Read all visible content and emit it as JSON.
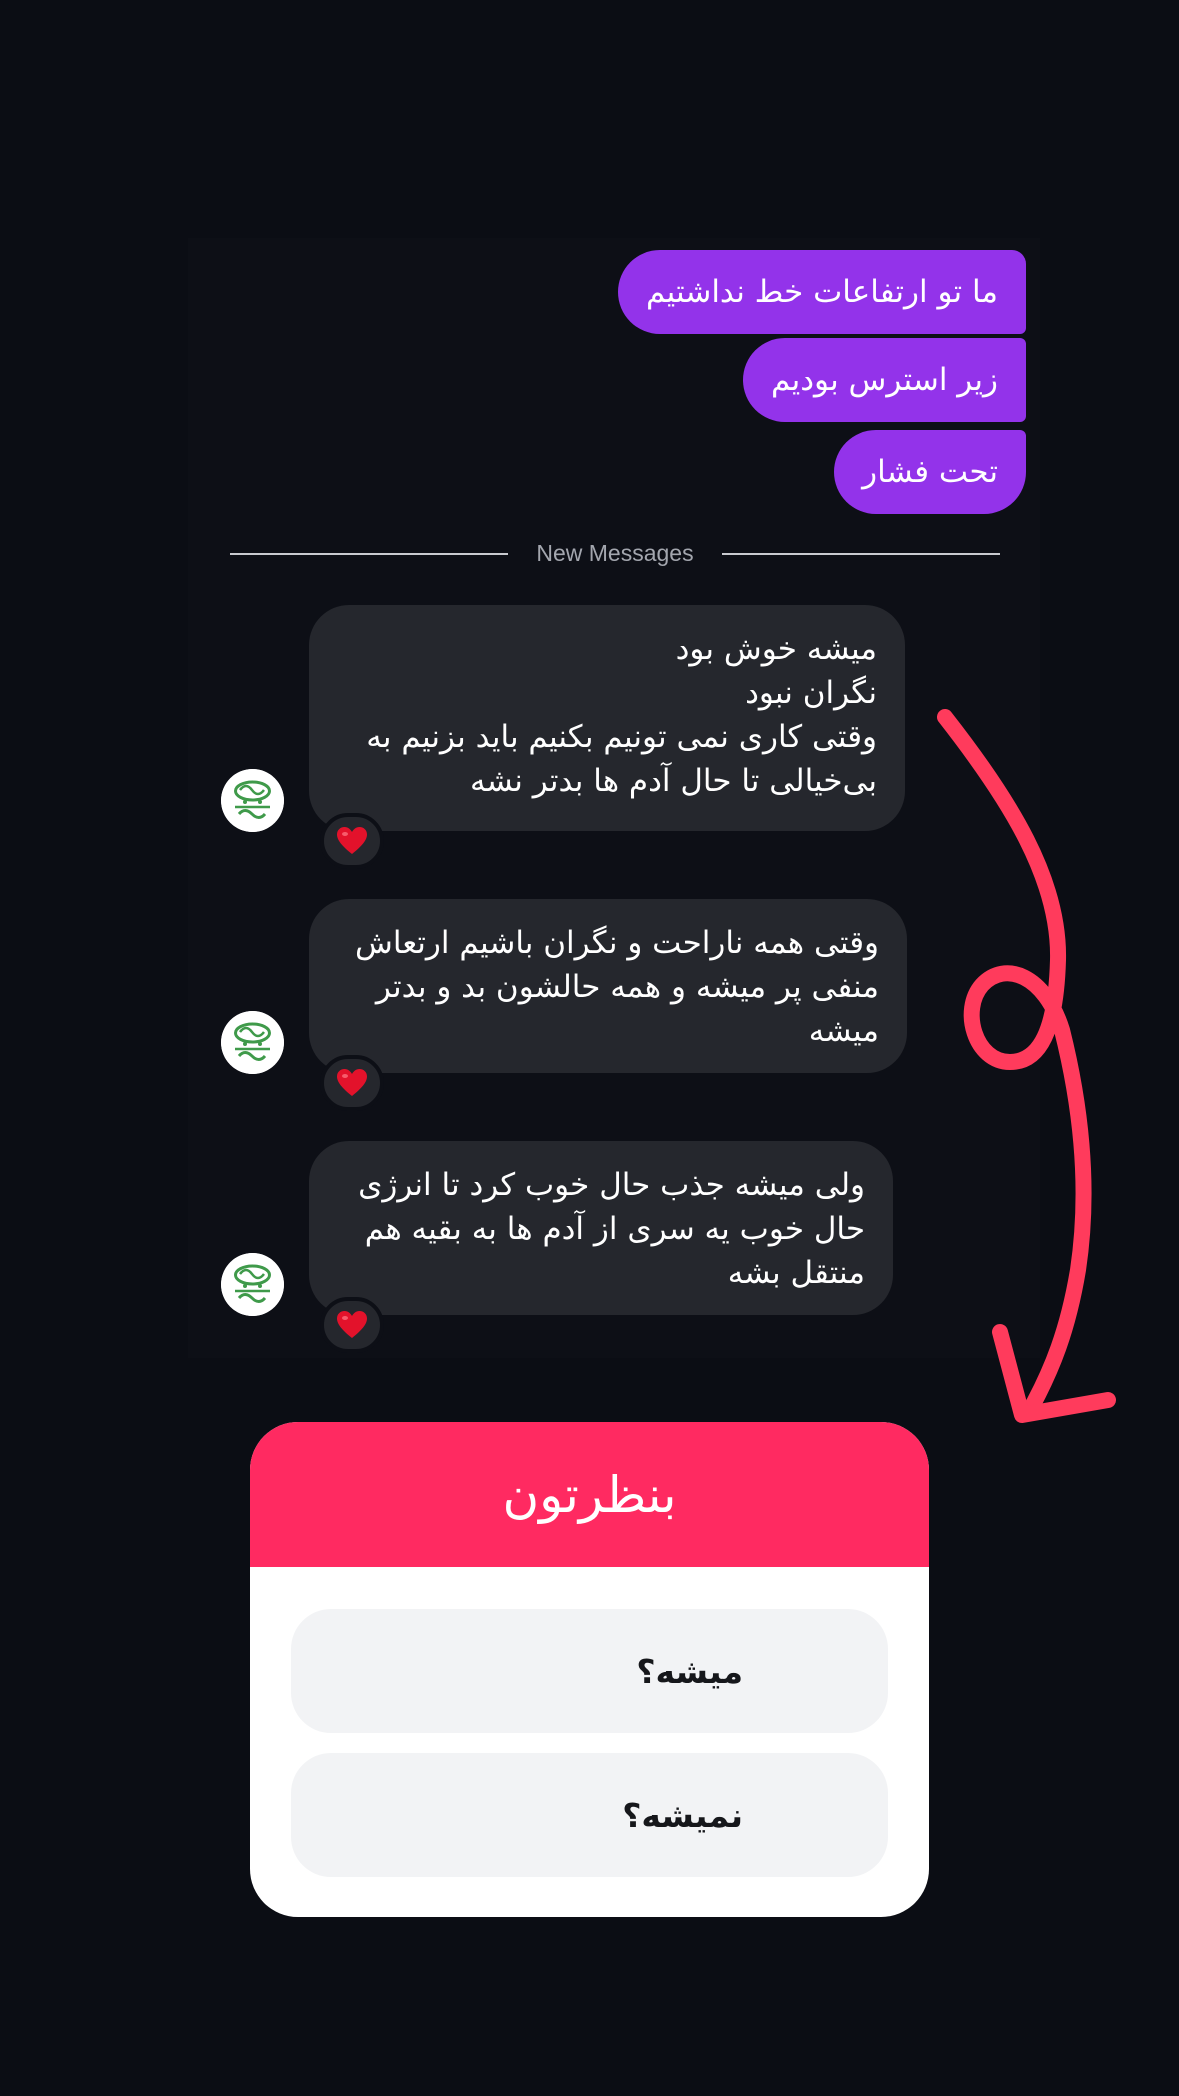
{
  "outgoing_messages": [
    "ما تو ارتفاعات خط نداشتیم",
    "زیر استرس بودیم",
    "تحت فشار"
  ],
  "divider": {
    "label": "New Messages"
  },
  "incoming_messages": [
    {
      "lines": [
        "میشه خوش بود",
        "نگران نبود",
        "وقتی کاری نمی تونیم بکنیم باید بزنیم به",
        "بی‌خیالی تا حال آدم ها بدتر نشه"
      ],
      "reaction": "❤️"
    },
    {
      "lines": [
        "وقتی همه ناراحت و نگران باشیم ارتعاش",
        "منفی پر میشه و همه حالشون بد و بدتر",
        "میشه"
      ],
      "reaction": "❤️"
    },
    {
      "lines": [
        "ولی میشه جذب حال خوب کرد تا انرژی",
        "حال خوب یه سری از آدم ها به بقیه هم",
        "منتقل بشه"
      ],
      "reaction": "❤️"
    }
  ],
  "poll": {
    "title": "بنظرتون",
    "options": [
      "میشه؟",
      "نمیشه؟"
    ]
  },
  "colors": {
    "background": "#0b0d14",
    "outgoing_bubble": "#9333ea",
    "incoming_bubble": "#25272d",
    "poll_header": "#ff2a61",
    "annotation_arrow": "#ff3b5c"
  },
  "icons": {
    "reaction": "heart-icon",
    "avatar": "avatar-logo-icon"
  }
}
